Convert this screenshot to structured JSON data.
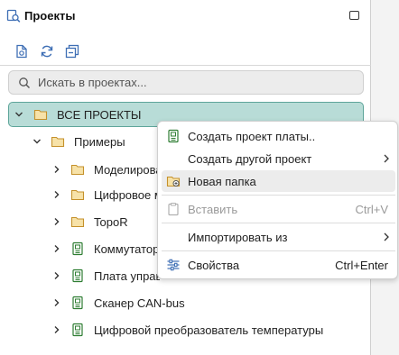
{
  "panel": {
    "title": "Проекты"
  },
  "search": {
    "placeholder": "Искать в проектах..."
  },
  "tree": {
    "root_label": "ВСЕ ПРОЕКТЫ",
    "examples_label": "Примеры",
    "items": [
      {
        "label": "Моделирование",
        "icon": "folder-icon"
      },
      {
        "label": "Цифровое моделирование",
        "icon": "folder-icon"
      },
      {
        "label": "TopoR",
        "icon": "folder-icon"
      },
      {
        "label": "Коммутатор",
        "icon": "board-project-icon"
      },
      {
        "label": "Плата управления",
        "icon": "board-project-icon"
      },
      {
        "label": "Сканер CAN-bus",
        "icon": "board-project-icon"
      },
      {
        "label": "Цифровой преобразователь температуры",
        "icon": "board-project-icon"
      }
    ]
  },
  "context_menu": {
    "items": [
      {
        "label": "Создать проект платы..",
        "shortcut": "",
        "icon": "board-project-icon",
        "disabled": false,
        "submenu": false
      },
      {
        "label": "Создать другой проект",
        "shortcut": "",
        "icon": "",
        "disabled": false,
        "submenu": true
      },
      {
        "label": "Новая папка",
        "shortcut": "",
        "icon": "new-folder-icon",
        "disabled": false,
        "submenu": false
      },
      {
        "label": "Вставить",
        "shortcut": "Ctrl+V",
        "icon": "clipboard-icon",
        "disabled": true,
        "submenu": false
      },
      {
        "label": "Импортировать из",
        "shortcut": "",
        "icon": "",
        "disabled": false,
        "submenu": true
      },
      {
        "label": "Свойства",
        "shortcut": "Ctrl+Enter",
        "icon": "sliders-icon",
        "disabled": false,
        "submenu": false
      }
    ]
  },
  "colors": {
    "accent": "#3f8f84",
    "selection_bg": "#b8dcd7",
    "folder": "#e8b84a",
    "board_icon": "#2e7d32"
  }
}
